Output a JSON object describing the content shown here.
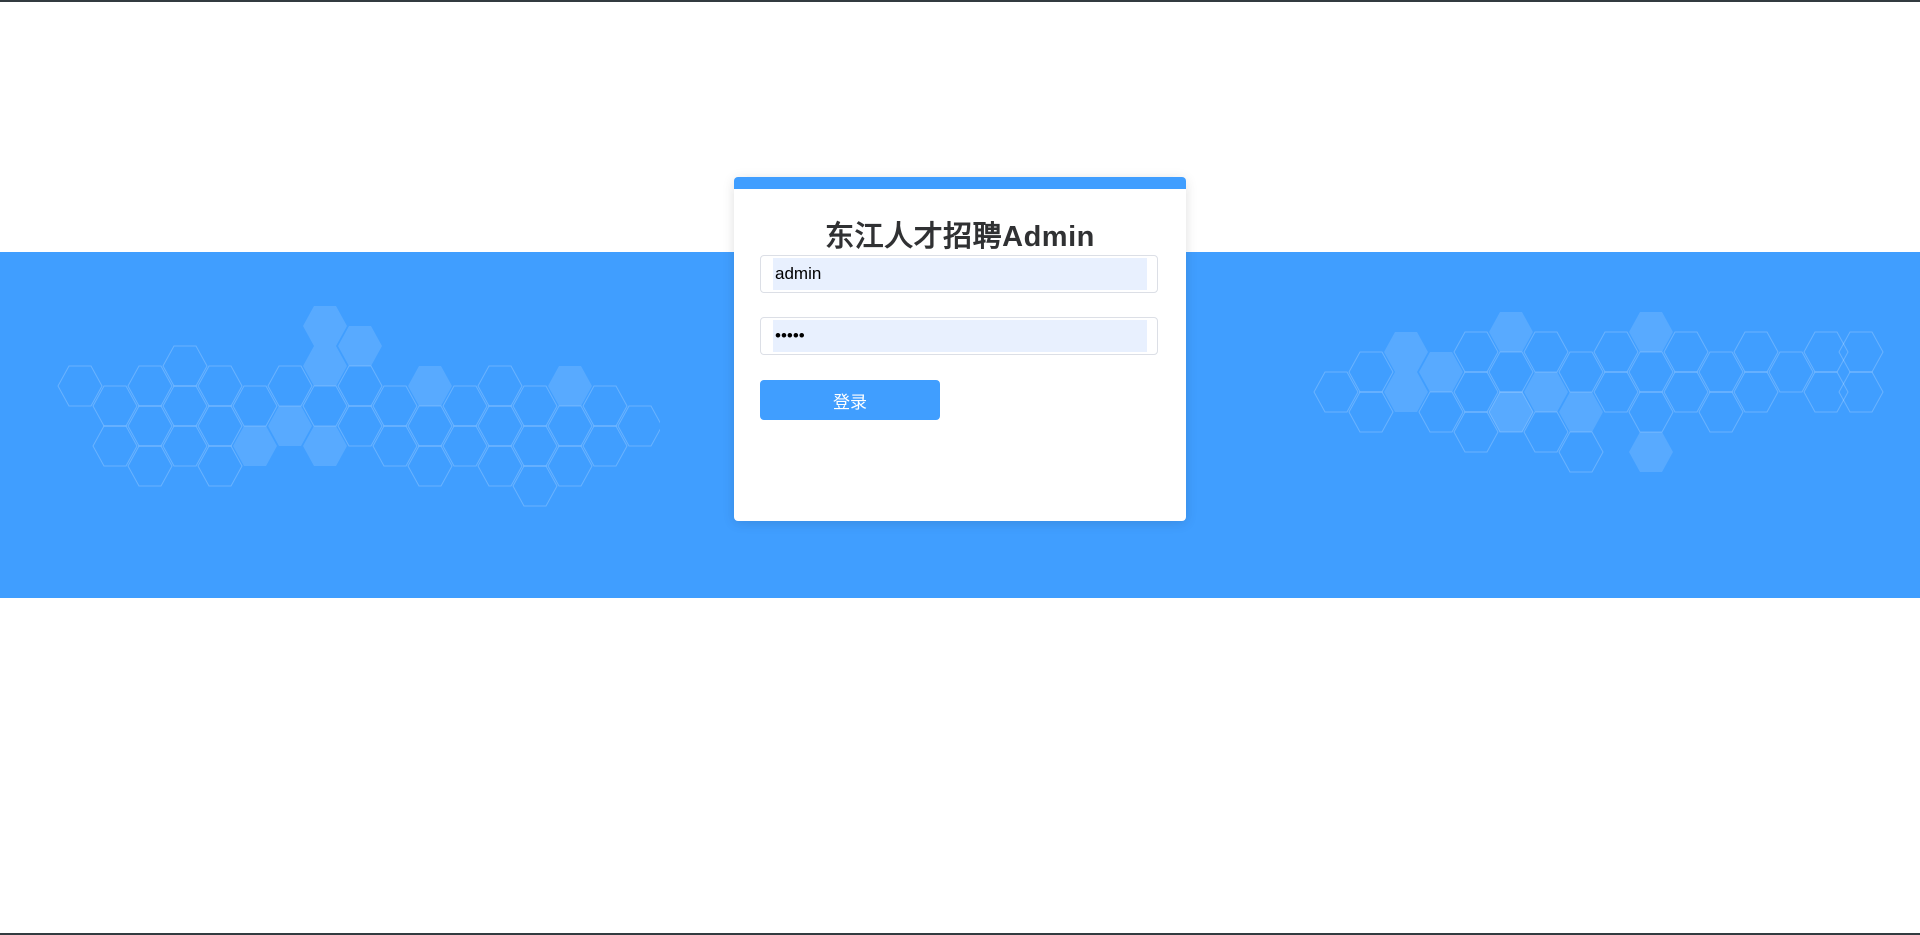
{
  "login": {
    "title": "东江人才招聘Admin",
    "username_value": "admin",
    "password_value": "admin",
    "submit_label": "登录"
  },
  "colors": {
    "accent": "#409eff",
    "title": "#303133",
    "input_bg": "#e8f0fe"
  }
}
